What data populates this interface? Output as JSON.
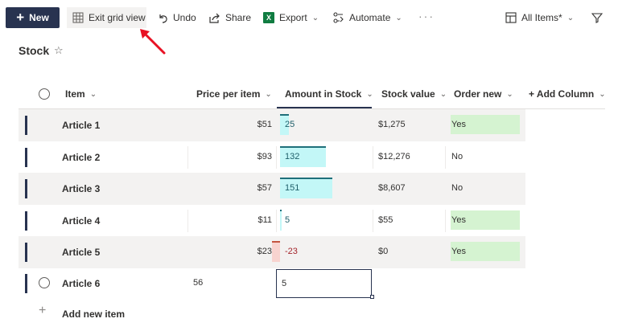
{
  "toolbar": {
    "new_label": "New",
    "exit_grid_label": "Exit grid view",
    "undo_label": "Undo",
    "share_label": "Share",
    "export_label": "Export",
    "automate_label": "Automate",
    "more_label": "···",
    "view_label": "All Items*",
    "excel_badge": "X"
  },
  "list": {
    "title": "Stock"
  },
  "columns": {
    "item": "Item",
    "price": "Price per item",
    "amount": "Amount in Stock",
    "value": "Stock value",
    "order": "Order new",
    "add": "+ Add Column"
  },
  "rows": [
    {
      "item": "Article 1",
      "price": "$51",
      "amount": "25",
      "amount_num": 25,
      "value": "$1,275",
      "order": "Yes"
    },
    {
      "item": "Article 2",
      "price": "$93",
      "amount": "132",
      "amount_num": 132,
      "value": "$12,276",
      "order": "No"
    },
    {
      "item": "Article 3",
      "price": "$57",
      "amount": "151",
      "amount_num": 151,
      "value": "$8,607",
      "order": "No"
    },
    {
      "item": "Article 4",
      "price": "$11",
      "amount": "5",
      "amount_num": 5,
      "value": "$55",
      "order": "Yes"
    },
    {
      "item": "Article 5",
      "price": "$23",
      "amount": "-23",
      "amount_num": -23,
      "value": "$0",
      "order": "Yes"
    }
  ],
  "edit_row": {
    "item": "Article 6",
    "price": "56",
    "amount": "5"
  },
  "add_new_label": "Add new item",
  "colors": {
    "accent": "#283350",
    "amount_bar": "#c3f7f7",
    "amount_bar_border": "#1f6f7a",
    "negative_bar": "#f8d3cf",
    "order_yes": "#d5f3d1",
    "arrow": "#e81123"
  }
}
